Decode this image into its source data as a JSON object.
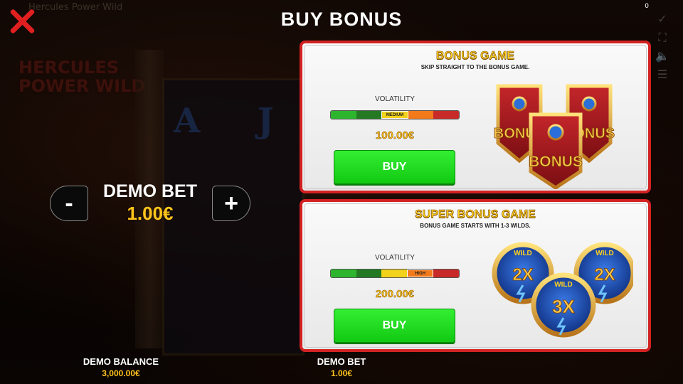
{
  "background": {
    "game_title": "Hercules Power Wild",
    "logo_line1": "HERCULES",
    "logo_line2": "POWER WILD",
    "symbols": [
      "A",
      "J"
    ]
  },
  "header": {
    "title": "BUY BONUS",
    "counter": "0",
    "close_icon": "close-icon"
  },
  "bet_control": {
    "label": "DEMO BET",
    "value": "1.00€",
    "minus_label": "-",
    "plus_label": "+"
  },
  "panels": [
    {
      "title": "BONUS GAME",
      "description": "SKIP STRAIGHT TO THE BONUS GAME.",
      "volatility_label": "VOLATILITY",
      "volatility_level": "MEDIUM",
      "volatility_segment": 3,
      "price": "100.00€",
      "buy_label": "BUY",
      "art_text": [
        "BONUS",
        "BONUS",
        "BONUS"
      ]
    },
    {
      "title": "SUPER BONUS GAME",
      "description": "BONUS GAME STARTS WITH 1-3 WILDS.",
      "volatility_label": "VOLATILITY",
      "volatility_level": "HIGH",
      "volatility_segment": 4,
      "price": "200.00€",
      "buy_label": "BUY",
      "art_text": [
        "2X",
        "3X",
        "2X"
      ],
      "art_badge": "WILD"
    }
  ],
  "footer": {
    "balance_label": "DEMO BALANCE",
    "balance_value": "3,000.00€",
    "bet_label": "DEMO BET",
    "bet_value": "1.00€"
  },
  "colors": {
    "panel_border": "#d32222",
    "buy_green": "#22dd22",
    "gold": "#ffc51a",
    "close_red": "#e02020"
  }
}
